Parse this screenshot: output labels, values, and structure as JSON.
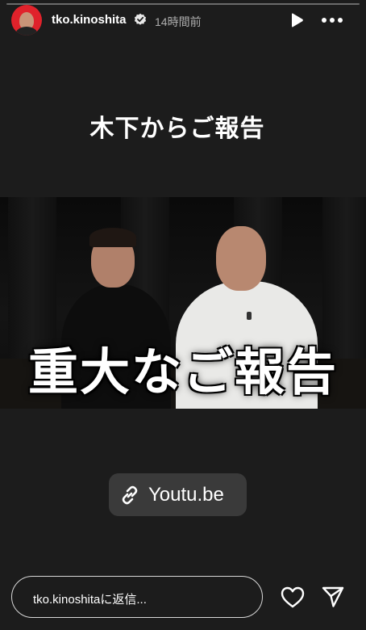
{
  "header": {
    "username": "tko.kinoshita",
    "timestamp": "14時間前",
    "verified_icon": "verified-badge-icon",
    "play_icon": "play-icon",
    "more_icon": "more-horizontal-icon"
  },
  "story": {
    "caption": "木下からご報告",
    "thumbnail_overlay_text": "重大なご報告",
    "link_sticker": {
      "label": "Youtu.be",
      "icon": "link-icon"
    }
  },
  "footer": {
    "reply_placeholder": "tko.kinoshitaに返信...",
    "like_icon": "heart-icon",
    "send_icon": "send-icon"
  },
  "colors": {
    "background": "#1c1c1c",
    "avatar_ring": "#e0222b",
    "sticker_bg": "#3a3a3a",
    "muted_text": "#aeaeae"
  }
}
